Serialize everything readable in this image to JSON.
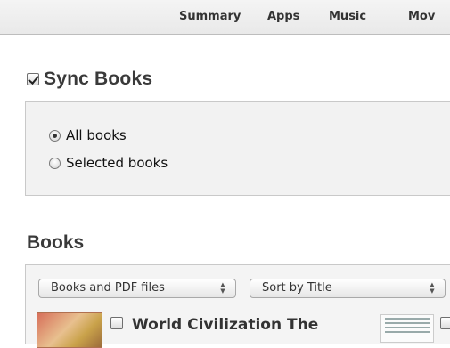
{
  "tabs": [
    "Summary",
    "Apps",
    "Music",
    "Mov"
  ],
  "sync": {
    "label": "Sync Books",
    "checked": true
  },
  "sync_options": [
    {
      "label": "All books",
      "selected": true
    },
    {
      "label": "Selected books",
      "selected": false
    }
  ],
  "books": {
    "heading": "Books",
    "filter_select": "Books and PDF files",
    "sort_select": "Sort by Title",
    "items": [
      {
        "title": "World Civilization The",
        "checked": false
      }
    ]
  }
}
